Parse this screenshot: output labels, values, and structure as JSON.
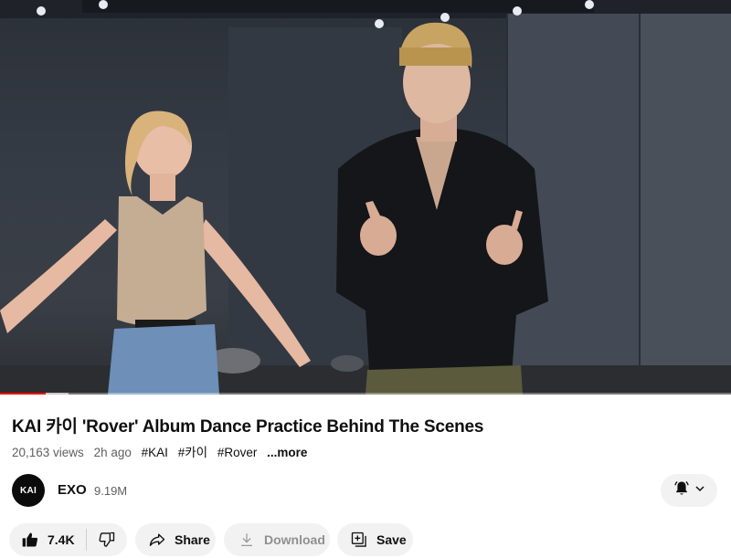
{
  "video": {
    "progress_fraction": 0.062,
    "buffer_fraction": 0.093
  },
  "title": "KAI 카이 'Rover' Album Dance Practice Behind The Scenes",
  "meta": {
    "views": "20,163 views",
    "age": "2h ago",
    "tags": [
      "#KAI",
      "#카이",
      "#Rover"
    ],
    "more": "...more"
  },
  "channel": {
    "avatar_text": "KAI",
    "name": "EXO",
    "subscribers": "9.19M"
  },
  "actions": {
    "likes": "7.4K",
    "share": "Share",
    "download": "Download",
    "save": "Save"
  },
  "icons": {
    "like": "thumbs-up-icon",
    "dislike": "thumbs-down-icon",
    "share": "share-arrow-icon",
    "download": "download-icon",
    "save": "playlist-add-icon",
    "notify": "bell-icon",
    "chevron": "chevron-down-icon"
  },
  "colors": {
    "progress": "#ff0000",
    "pill_bg": "#f2f2f2",
    "secondary_text": "#606060"
  }
}
